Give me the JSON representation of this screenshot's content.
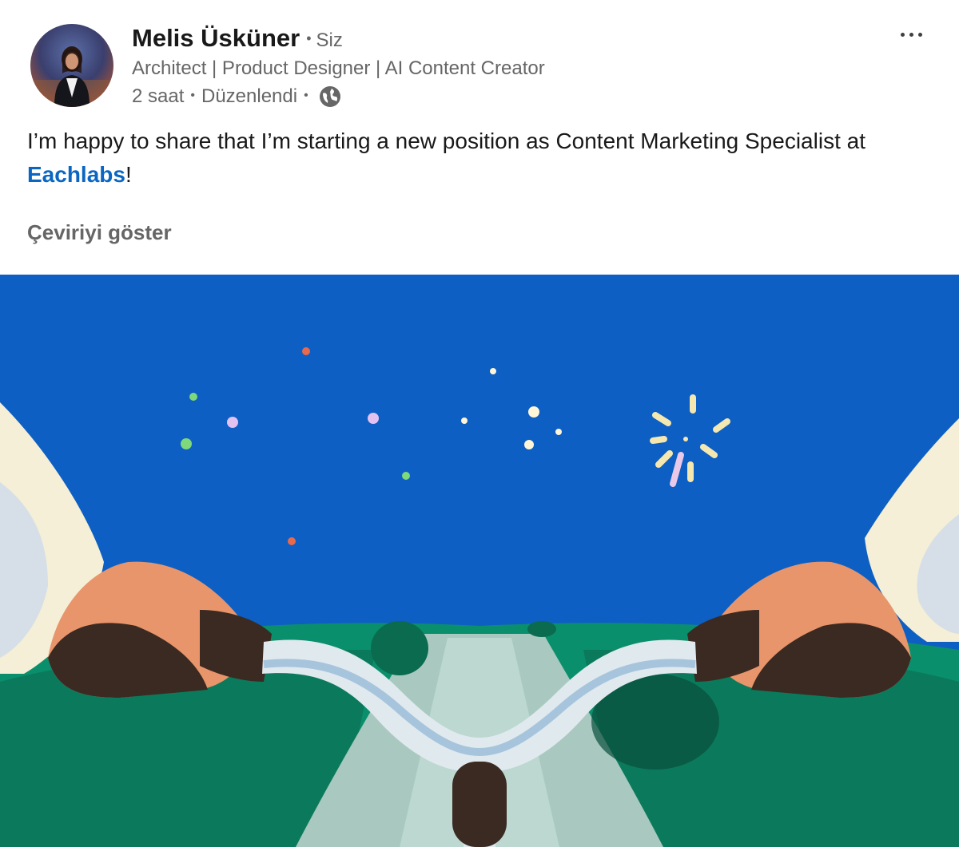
{
  "post": {
    "author": {
      "name": "Melis Üsküner",
      "relation": "Siz",
      "headline": "Architect | Product Designer | AI Content Creator"
    },
    "meta": {
      "time": "2 saat",
      "edited": "Düzenlendi",
      "visibility_icon": "globe-icon"
    },
    "text": {
      "before_link": "I’m happy to share that I’m starting a new position as Content Marketing Specialist at ",
      "company_link": "Eachlabs",
      "after_link": "!"
    },
    "translate_label": "Çeviriyi göster",
    "menu_icon": "more-options-icon"
  },
  "colors": {
    "link": "#0a66c2",
    "sky": "#0d5fc4",
    "muted_text": "#666666"
  }
}
